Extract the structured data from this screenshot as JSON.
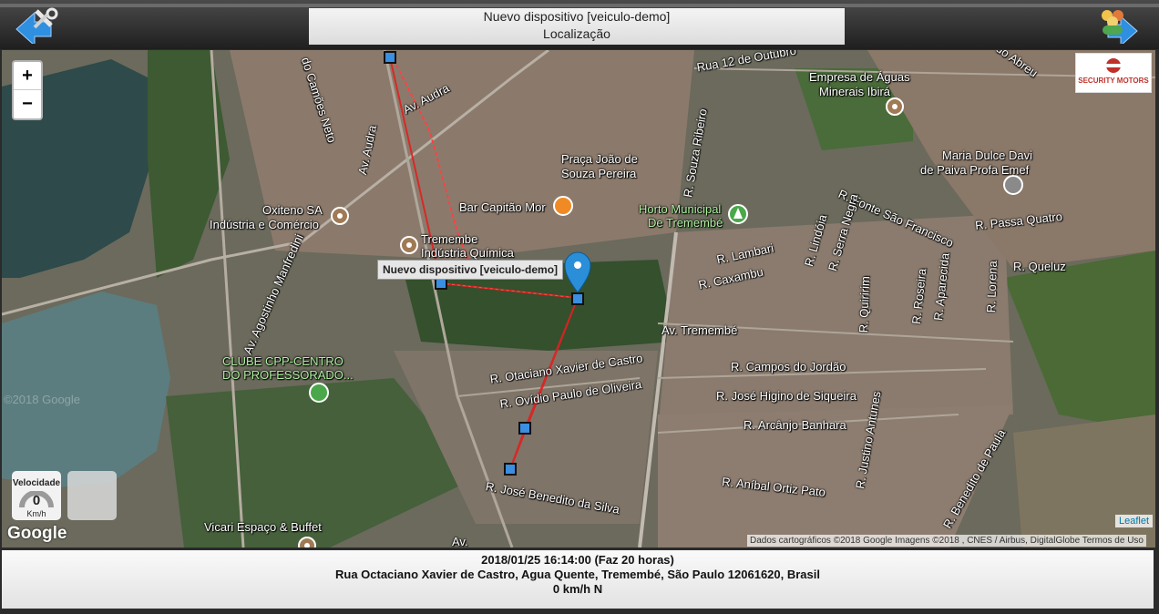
{
  "header": {
    "device_name": "Nuevo dispositivo [veiculo-demo]",
    "page": "Localização",
    "left_icon": "settings-back-icon",
    "right_icon": "users-forward-icon"
  },
  "map": {
    "zoom_in": "+",
    "zoom_out": "−",
    "tooltip": "Nuevo dispositivo [veiculo-demo]",
    "logo_text": "SECURITY MOTORS",
    "speed_label": "Velocidade",
    "speed_value": "0",
    "speed_unit": "Km/h",
    "google": "Google",
    "attribution": "Dados cartográficos ©2018 Google Imagens ©2018 , CNES / Airbus, DigitalGlobe    Termos de Uso",
    "leaflet": "Leaflet",
    "watermark": "©2018 Google",
    "labels": {
      "camoes": "do Camões Neto",
      "audra1": "Av. Audra",
      "audra2": "Av. Audra",
      "rua12": "Rua 12 de Outubro",
      "abreu": "do Abreu",
      "empresa1": "Empresa de Águas",
      "empresa2": "Minerais Ibirá",
      "praca1": "Praça João de",
      "praca2": "Souza Pereira",
      "souza": "R. Souza Ribeiro",
      "maria1": "Maria Dulce Davi",
      "maria2": "de Paiva Profa Emef",
      "oxiteno1": "Oxiteno SA",
      "oxiteno2": "Indústria e Comércio",
      "bar": "Bar Capitão Mor",
      "horto1": "Horto Municipal",
      "horto2": "De Tremembé",
      "fonte": "R. Fonte São Francisco",
      "passa": "R. Passa Quatro",
      "tremembe1": "Tremembe",
      "tremembe2": "Indústria Química",
      "lambari": "R. Lambari",
      "caxambu": "R. Caxambu",
      "lindoia": "R. Lindóia",
      "serra": "R. Serra Negra",
      "queluz": "R. Queluz",
      "agostinho": "Av. Agostinho Manfredini",
      "avtremembe": "Av. Tremembé",
      "quiririm": "R. Quiririm",
      "roseira": "R. Roseira",
      "aparecida": "R. Aparecida",
      "lorena": "R. Lorena",
      "clube1": "CLUBE CPP-CENTRO",
      "clube2": "DO PROFESSORADO...",
      "otaciano": "R. Otaciano Xavier de Castro",
      "ovidio": "R. Ovídio Paulo de Oliveira",
      "campos": "R. Campos do Jordão",
      "higino": "R. José Higino de Siqueira",
      "arcanjo": "R. Arcânjo Banhara",
      "justino": "R. Justino Antunes",
      "anibal": "R. Aníbal Ortiz Pato",
      "benedito": "R. José Benedito da Silva",
      "beneditop": "R. Benedito de Paula",
      "vicari": "Vicari Espaço & Buffet",
      "audra_s": "Av."
    }
  },
  "footer": {
    "datetime": "2018/01/25 16:14:00 (Faz 20 horas)",
    "address": "Rua Octaciano Xavier de Castro, Agua Quente, Tremembé, São Paulo 12061620, Brasil",
    "speed": "0 km/h N"
  },
  "colors": {
    "route": "#e02020",
    "marker": "#2a8fd8",
    "poi": "#a07a55"
  }
}
